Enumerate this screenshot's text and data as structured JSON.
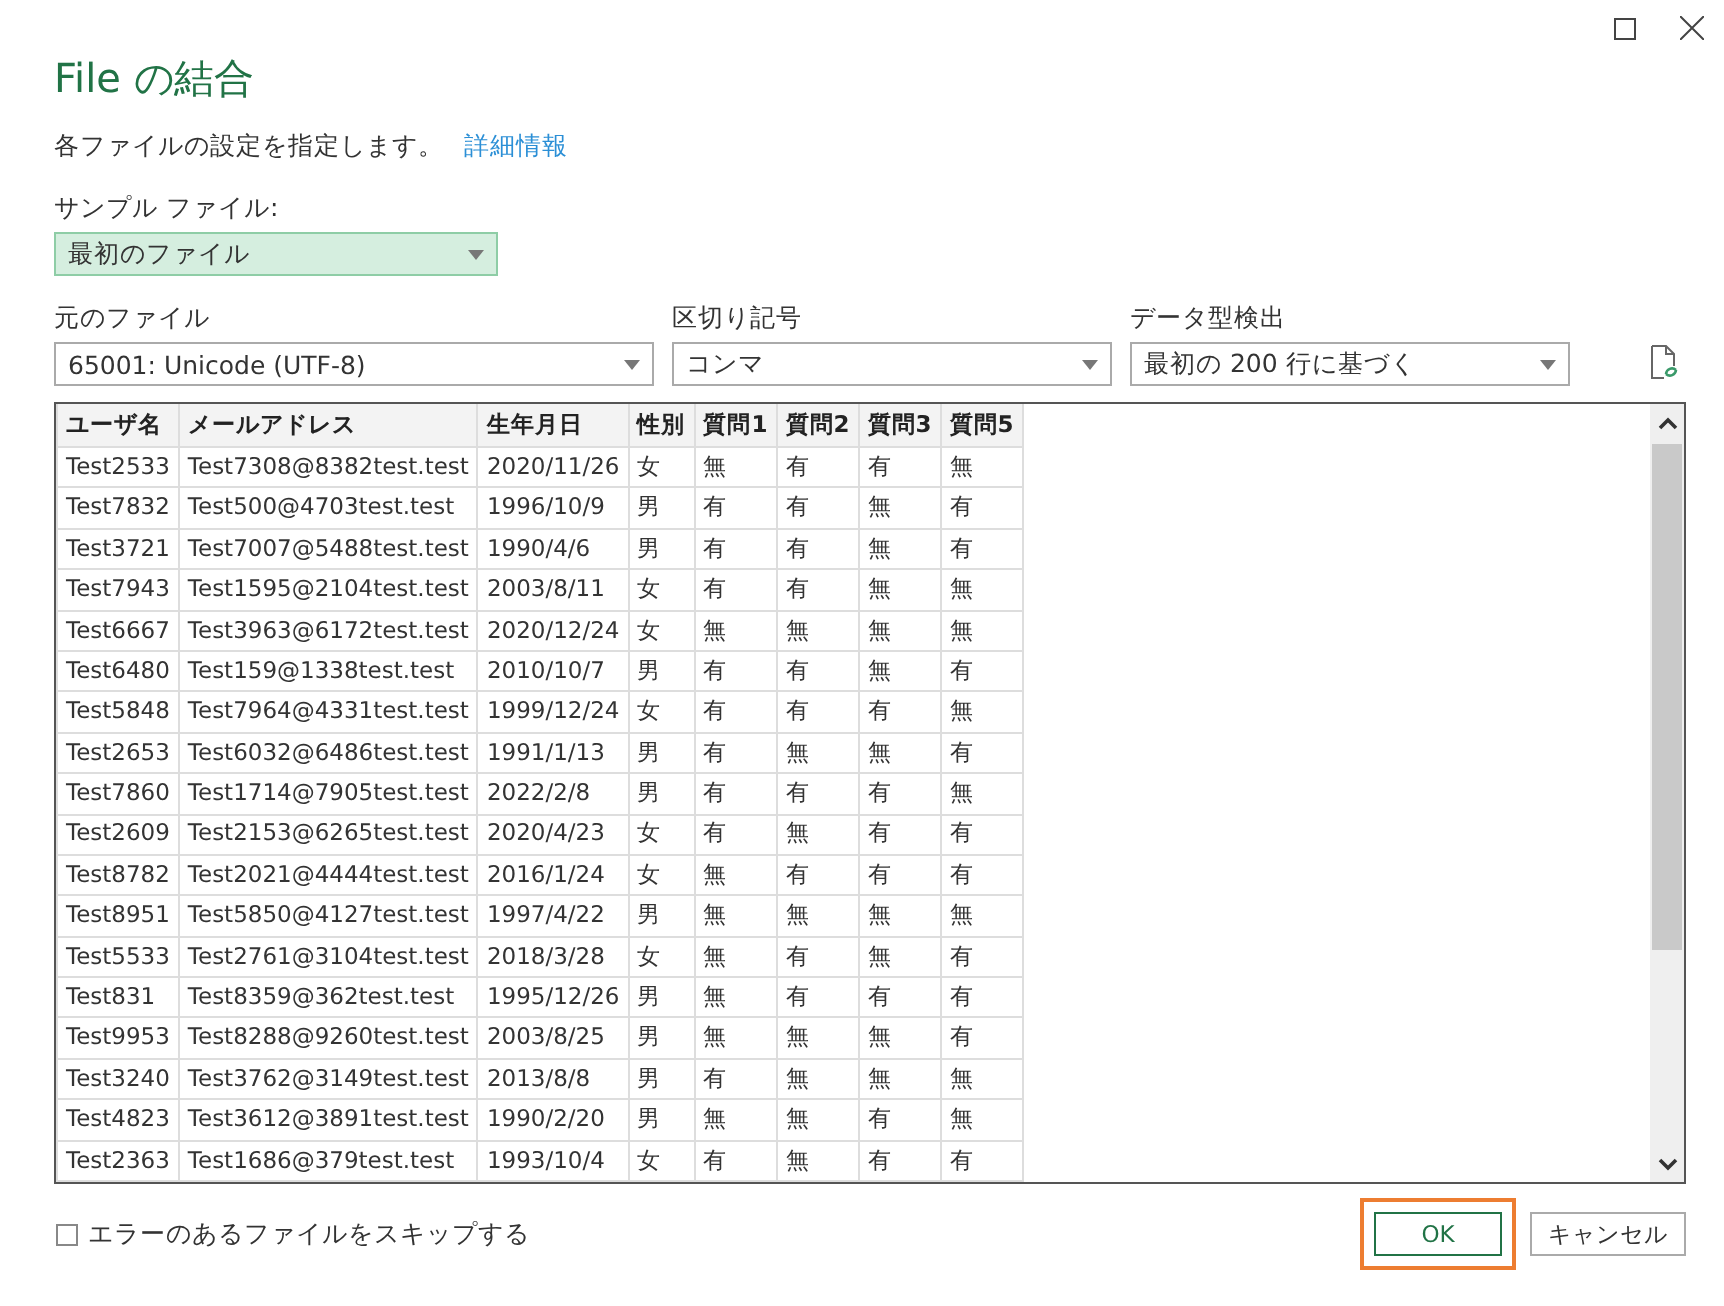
{
  "title": "File の結合",
  "subtitle": {
    "text": "各ファイルの設定を指定します。",
    "link": "詳細情報"
  },
  "sample_file": {
    "label": "サンプル ファイル:",
    "value": "最初のファイル"
  },
  "options": [
    {
      "label": "元のファイル",
      "value": "65001: Unicode (UTF-8)"
    },
    {
      "label": "区切り記号",
      "value": "コンマ"
    },
    {
      "label": "データ型検出",
      "value": "最初の 200 行に基づく"
    }
  ],
  "table": {
    "columns": [
      "ユーザ名",
      "メールアドレス",
      "生年月日",
      "性別",
      "質問1",
      "質問2",
      "質問3",
      "質問5"
    ],
    "rows": [
      [
        "Test2533",
        "Test7308@8382test.test",
        "2020/11/26",
        "女",
        "無",
        "有",
        "有",
        "無"
      ],
      [
        "Test7832",
        "Test500@4703test.test",
        "1996/10/9",
        "男",
        "有",
        "有",
        "無",
        "有"
      ],
      [
        "Test3721",
        "Test7007@5488test.test",
        "1990/4/6",
        "男",
        "有",
        "有",
        "無",
        "有"
      ],
      [
        "Test7943",
        "Test1595@2104test.test",
        "2003/8/11",
        "女",
        "有",
        "有",
        "無",
        "無"
      ],
      [
        "Test6667",
        "Test3963@6172test.test",
        "2020/12/24",
        "女",
        "無",
        "無",
        "無",
        "無"
      ],
      [
        "Test6480",
        "Test159@1338test.test",
        "2010/10/7",
        "男",
        "有",
        "有",
        "無",
        "有"
      ],
      [
        "Test5848",
        "Test7964@4331test.test",
        "1999/12/24",
        "女",
        "有",
        "有",
        "有",
        "無"
      ],
      [
        "Test2653",
        "Test6032@6486test.test",
        "1991/1/13",
        "男",
        "有",
        "無",
        "無",
        "有"
      ],
      [
        "Test7860",
        "Test1714@7905test.test",
        "2022/2/8",
        "男",
        "有",
        "有",
        "有",
        "無"
      ],
      [
        "Test2609",
        "Test2153@6265test.test",
        "2020/4/23",
        "女",
        "有",
        "無",
        "有",
        "有"
      ],
      [
        "Test8782",
        "Test2021@4444test.test",
        "2016/1/24",
        "女",
        "無",
        "有",
        "有",
        "有"
      ],
      [
        "Test8951",
        "Test5850@4127test.test",
        "1997/4/22",
        "男",
        "無",
        "無",
        "無",
        "無"
      ],
      [
        "Test5533",
        "Test2761@3104test.test",
        "2018/3/28",
        "女",
        "無",
        "有",
        "無",
        "有"
      ],
      [
        "Test831",
        "Test8359@362test.test",
        "1995/12/26",
        "男",
        "無",
        "有",
        "有",
        "有"
      ],
      [
        "Test9953",
        "Test8288@9260test.test",
        "2003/8/25",
        "男",
        "無",
        "無",
        "無",
        "有"
      ],
      [
        "Test3240",
        "Test3762@3149test.test",
        "2013/8/8",
        "男",
        "有",
        "無",
        "無",
        "無"
      ],
      [
        "Test4823",
        "Test3612@3891test.test",
        "1990/2/20",
        "男",
        "無",
        "無",
        "有",
        "無"
      ],
      [
        "Test2363",
        "Test1686@379test.test",
        "1993/10/4",
        "女",
        "有",
        "無",
        "有",
        "有"
      ]
    ]
  },
  "skip_errors": {
    "label": "エラーのあるファイルをスキップする",
    "checked": false
  },
  "buttons": [
    {
      "label": "OK",
      "focused": true
    },
    {
      "label": "キャンセル",
      "focused": false
    }
  ]
}
